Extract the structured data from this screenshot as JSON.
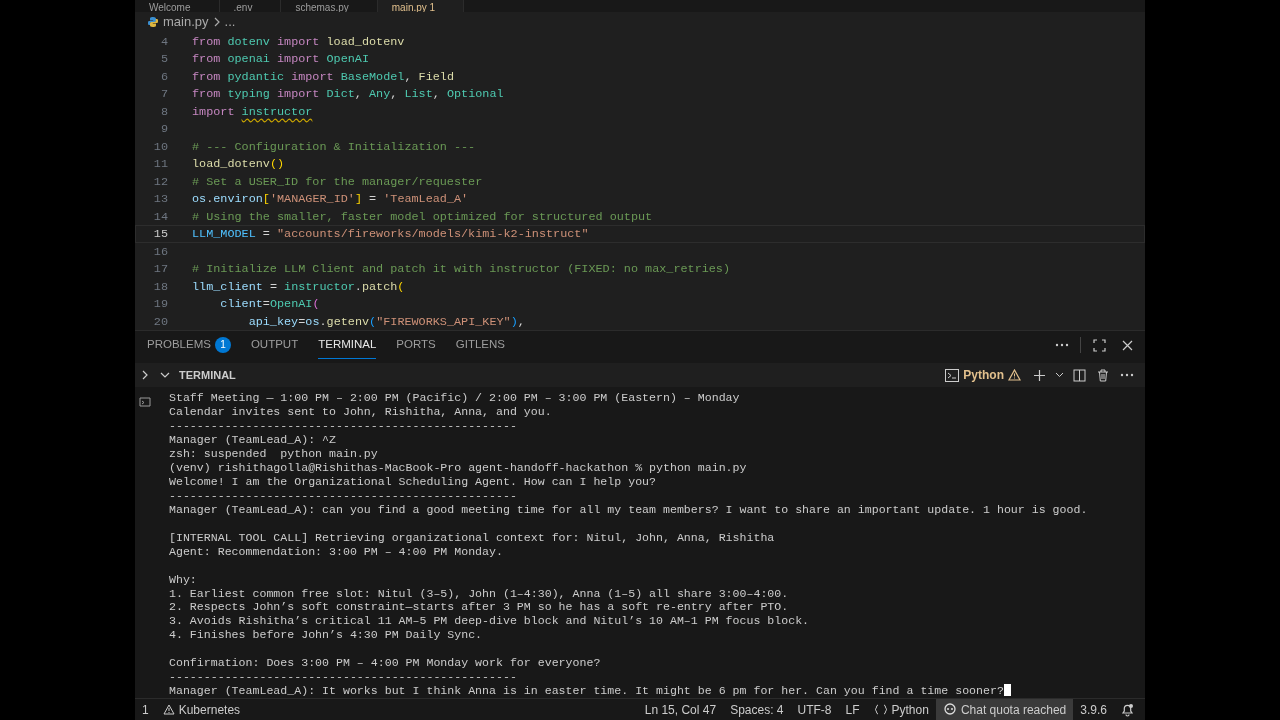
{
  "editor_tabs": [
    {
      "label": "Welcome",
      "selected": false
    },
    {
      "label": ".env",
      "selected": false
    },
    {
      "label": "schemas.py",
      "selected": false
    },
    {
      "label": "main.py",
      "badge": "1",
      "selected": true
    }
  ],
  "breadcrumb": [
    "main.py",
    "..."
  ],
  "code_lines": [
    {
      "number": "4",
      "current": false,
      "tokens": [
        {
          "text": "from",
          "kind": "kw"
        },
        {
          "text": " dotenv",
          "kind": "mod"
        },
        {
          "text": " import",
          "kind": "kw"
        },
        {
          "text": " load_dotenv",
          "kind": "fn"
        }
      ]
    },
    {
      "number": "5",
      "current": false,
      "tokens": [
        {
          "text": "from",
          "kind": "kw"
        },
        {
          "text": " openai",
          "kind": "mod"
        },
        {
          "text": " import",
          "kind": "kw"
        },
        {
          "text": " OpenAI",
          "kind": "cls"
        }
      ]
    },
    {
      "number": "6",
      "current": false,
      "tokens": [
        {
          "text": "from",
          "kind": "kw"
        },
        {
          "text": " pydantic",
          "kind": "mod"
        },
        {
          "text": " import",
          "kind": "kw"
        },
        {
          "text": " BaseModel",
          "kind": "cls"
        },
        {
          "text": ",",
          "kind": "plain"
        },
        {
          "text": " Field",
          "kind": "fn"
        }
      ]
    },
    {
      "number": "7",
      "current": false,
      "tokens": [
        {
          "text": "from",
          "kind": "kw"
        },
        {
          "text": " typing",
          "kind": "mod"
        },
        {
          "text": " import",
          "kind": "kw"
        },
        {
          "text": " Dict",
          "kind": "cls"
        },
        {
          "text": ",",
          "kind": "plain"
        },
        {
          "text": " Any",
          "kind": "cls"
        },
        {
          "text": ",",
          "kind": "plain"
        },
        {
          "text": " List",
          "kind": "cls"
        },
        {
          "text": ",",
          "kind": "plain"
        },
        {
          "text": " Optional",
          "kind": "cls"
        }
      ]
    },
    {
      "number": "8",
      "current": false,
      "tokens": [
        {
          "text": "import ",
          "kind": "kw"
        },
        {
          "text": "instructor",
          "kind": "warn"
        }
      ]
    },
    {
      "number": "9",
      "current": false
    },
    {
      "number": "10",
      "current": false,
      "tokens": [
        {
          "text": "# --- Configuration & Initialization ---",
          "kind": "cmt"
        }
      ]
    },
    {
      "number": "11",
      "current": false,
      "tokens": [
        {
          "text": "load_dotenv",
          "kind": "fn"
        },
        {
          "text": "()",
          "kind": "brk"
        }
      ]
    },
    {
      "number": "12",
      "current": false,
      "tokens": [
        {
          "text": "# Set a USER_ID for the manager/requester",
          "kind": "cmt"
        }
      ]
    },
    {
      "number": "13",
      "current": false,
      "tokens": [
        {
          "text": "os",
          "kind": "var"
        },
        {
          "text": ".",
          "kind": "plain"
        },
        {
          "text": "environ",
          "kind": "var"
        },
        {
          "text": "[",
          "kind": "brk"
        },
        {
          "text": "'MANAGER_ID'",
          "kind": "str"
        },
        {
          "text": "]",
          "kind": "brk"
        },
        {
          "text": " = ",
          "kind": "plain"
        },
        {
          "text": "'TeamLead_A'",
          "kind": "str"
        }
      ]
    },
    {
      "number": "14",
      "current": false,
      "tokens": [
        {
          "text": "# Using the smaller, faster model optimized for structured output",
          "kind": "cmt"
        }
      ]
    },
    {
      "number": "15",
      "current": true,
      "tokens": [
        {
          "text": "LLM_MODEL",
          "kind": "const"
        },
        {
          "text": " = ",
          "kind": "plain"
        },
        {
          "text": "\"accounts/fireworks/models/kimi-k2-instruct\"",
          "kind": "str"
        }
      ]
    },
    {
      "number": "16",
      "current": false
    },
    {
      "number": "17",
      "current": false,
      "tokens": [
        {
          "text": "# Initialize LLM Client and patch it with instructor (FIXED: no max_retries)",
          "kind": "cmt"
        }
      ]
    },
    {
      "number": "18",
      "current": false,
      "tokens": [
        {
          "text": "llm_client",
          "kind": "var"
        },
        {
          "text": " = ",
          "kind": "plain"
        },
        {
          "text": "instructor",
          "kind": "mod"
        },
        {
          "text": ".",
          "kind": "plain"
        },
        {
          "text": "patch",
          "kind": "fn"
        },
        {
          "text": "(",
          "kind": "brk"
        }
      ]
    },
    {
      "number": "19",
      "current": false,
      "tokens": [
        {
          "text": "    client",
          "kind": "var"
        },
        {
          "text": "=",
          "kind": "plain"
        },
        {
          "text": "OpenAI",
          "kind": "cls"
        },
        {
          "text": "(",
          "kind": "brk2"
        }
      ]
    },
    {
      "number": "20",
      "current": false,
      "tokens": [
        {
          "text": "        api_key",
          "kind": "var"
        },
        {
          "text": "=",
          "kind": "plain"
        },
        {
          "text": "os",
          "kind": "var"
        },
        {
          "text": ".",
          "kind": "plain"
        },
        {
          "text": "getenv",
          "kind": "fn"
        },
        {
          "text": "(",
          "kind": "brk3"
        },
        {
          "text": "\"FIREWORKS_API_KEY\"",
          "kind": "str"
        },
        {
          "text": ")",
          "kind": "brk3"
        },
        {
          "text": ",",
          "kind": "plain"
        }
      ]
    }
  ],
  "panel_tabs": [
    {
      "label": "PROBLEMS",
      "badge": "1",
      "selected": false
    },
    {
      "label": "OUTPUT",
      "selected": false
    },
    {
      "label": "TERMINAL",
      "selected": true
    },
    {
      "label": "PORTS",
      "selected": false
    },
    {
      "label": "GITLENS",
      "selected": false
    }
  ],
  "terminal": {
    "title": "TERMINAL",
    "shell": "Python",
    "lines": [
      {
        "kind": "text",
        "text": "Staff Meeting — 1:00 PM – 2:00 PM (Pacific) / 2:00 PM – 3:00 PM (Eastern) – Monday"
      },
      {
        "kind": "text",
        "text": "Calendar invites sent to John, Rishitha, Anna, and you."
      },
      {
        "kind": "text",
        "text": "--------------------------------------------------"
      },
      {
        "kind": "text",
        "text": "Manager (TeamLead_A): ^Z"
      },
      {
        "kind": "text",
        "text": "zsh: suspended  python main.py"
      },
      {
        "kind": "text",
        "text": "(venv) rishithagolla@Rishithas-MacBook-Pro agent-handoff-hackathon % python main.py"
      },
      {
        "kind": "text",
        "text": "Welcome! I am the Organizational Scheduling Agent. How can I help you?"
      },
      {
        "kind": "text",
        "text": "--------------------------------------------------"
      },
      {
        "kind": "text",
        "text": "Manager (TeamLead_A): can you find a good meeting time for all my team members? I want to share an important update. 1 hour is good."
      },
      {
        "kind": "blank"
      },
      {
        "kind": "text",
        "text": "[INTERNAL TOOL CALL] Retrieving organizational context for: Nitul, John, Anna, Rishitha"
      },
      {
        "kind": "text",
        "text": "Agent: Recommendation: 3:00 PM – 4:00 PM Monday."
      },
      {
        "kind": "blank"
      },
      {
        "kind": "text",
        "text": "Why:"
      },
      {
        "kind": "text",
        "text": "1. Earliest common free slot: Nitul (3–5), John (1–4:30), Anna (1–5) all share 3:00–4:00."
      },
      {
        "kind": "text",
        "text": "2. Respects John’s soft constraint—starts after 3 PM so he has a soft re-entry after PTO."
      },
      {
        "kind": "text",
        "text": "3. Avoids Rishitha’s critical 11 AM–5 PM deep-dive block and Nitul’s 10 AM–1 PM focus block."
      },
      {
        "kind": "text",
        "text": "4. Finishes before John’s 4:30 PM Daily Sync."
      },
      {
        "kind": "blank"
      },
      {
        "kind": "text",
        "text": "Confirmation: Does 3:00 PM – 4:00 PM Monday work for everyone?"
      },
      {
        "kind": "text",
        "text": "--------------------------------------------------"
      },
      {
        "kind": "input",
        "text": "Manager (TeamLead_A): It works but I think Anna is in easter time. It might be 6 pm for her. Can you find a time sooner?"
      }
    ]
  },
  "status_bar": {
    "left": [
      {
        "kind": "text",
        "text": "1"
      },
      {
        "kind": "warning",
        "text": "Kubernetes"
      }
    ],
    "right": [
      {
        "kind": "text",
        "text": "Ln 15, Col 47"
      },
      {
        "kind": "text",
        "text": "Spaces: 4"
      },
      {
        "kind": "text",
        "text": "UTF-8"
      },
      {
        "kind": "text",
        "text": "LF"
      },
      {
        "kind": "braces",
        "text": "Python"
      },
      {
        "kind": "chat",
        "text": "Chat quota reached"
      },
      {
        "kind": "text",
        "text": "3.9.6"
      },
      {
        "kind": "bell"
      }
    ]
  }
}
